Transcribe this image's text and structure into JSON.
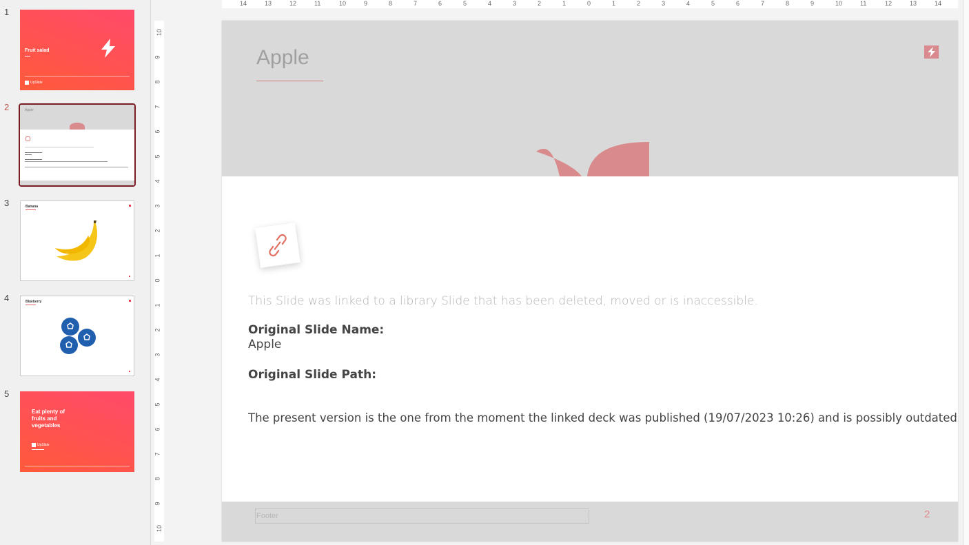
{
  "thumbnails": [
    {
      "number": "1",
      "title": "Fruit salad",
      "brand": "UpSlide"
    },
    {
      "number": "2",
      "title": "Apple"
    },
    {
      "number": "3",
      "title": "Banana"
    },
    {
      "number": "4",
      "title": "Blueberry"
    },
    {
      "number": "5",
      "title": "Eat plenty of fruits and vegetables",
      "title_lines": [
        "Eat plenty of",
        "fruits and",
        "vegetables"
      ],
      "brand": "UpSlide"
    }
  ],
  "ruler": {
    "top_ticks": [
      "14",
      "13",
      "12",
      "11",
      "10",
      "9",
      "8",
      "7",
      "6",
      "5",
      "4",
      "3",
      "2",
      "1",
      "0",
      "1",
      "2",
      "3",
      "4",
      "5",
      "6",
      "7",
      "8",
      "9",
      "10",
      "11",
      "12",
      "13",
      "14"
    ],
    "left_ticks": [
      "10",
      "9",
      "8",
      "7",
      "6",
      "5",
      "4",
      "3",
      "2",
      "1",
      "0",
      "1",
      "2",
      "3",
      "4",
      "5",
      "6",
      "7",
      "8",
      "9",
      "10"
    ]
  },
  "slide": {
    "title": "Apple",
    "message": "This Slide was linked to a library Slide that has been deleted, moved or is inaccessible.",
    "original_name_label": "Original Slide Name:",
    "original_name_value": "Apple",
    "original_path_label": "Original Slide Path:",
    "note": "The present version is the one from the moment the linked deck was published (19/07/2023 10:26) and is possibly outdated.",
    "footer_placeholder": "Footer",
    "slide_number": "2"
  },
  "colors": {
    "brand_gradient_start": "#ff4a6a",
    "brand_gradient_end": "#ff5a3a",
    "selection_border": "#7a1a22",
    "leaf": "#d98a8c",
    "banana": "#f5c518",
    "blueberry": "#1f5fae"
  }
}
